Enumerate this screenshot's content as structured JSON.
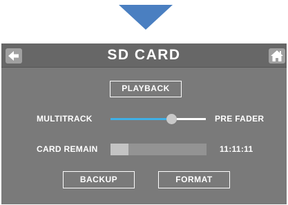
{
  "screen": {
    "title": "SD CARD",
    "back_icon": "arrow-left-icon",
    "home_icon": "home-icon"
  },
  "playback_label": "PLAYBACK",
  "rec_point": {
    "left_label": "MULTITRACK",
    "right_label": "PRE FADER",
    "slider_value": 0.64
  },
  "card_remain": {
    "label": "CARD REMAIN",
    "time": "11:11:11",
    "used_fraction": 0.19
  },
  "backup_label": "BACKUP",
  "format_label": "FORMAT",
  "colors": {
    "accent": "#3fb0e6",
    "panel": "#7a7a7a",
    "title_bar": "#676767",
    "arrow": "#4a7fc1"
  }
}
